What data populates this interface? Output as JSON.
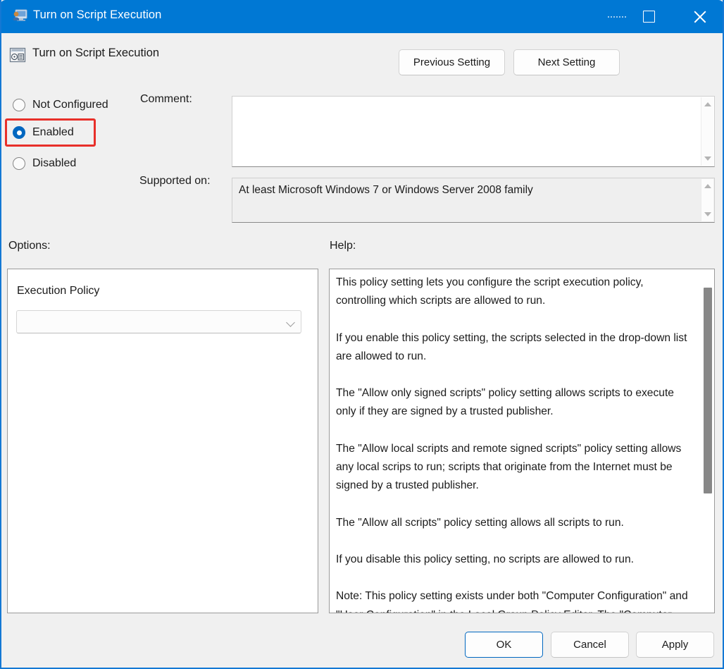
{
  "window": {
    "title": "Turn on Script Execution",
    "title_icon": "policy-monitor-icon",
    "accent_color": "#0078d4",
    "border_color": "#1478d4",
    "controls": {
      "minimize_label": "Minimize",
      "maximize_label": "Maximize",
      "close_label": "Close"
    }
  },
  "header": {
    "icon": "policy-setting-icon",
    "title": "Turn on Script Execution",
    "previous_setting_label": "Previous Setting",
    "next_setting_label": "Next Setting"
  },
  "state_options": {
    "items": [
      {
        "label": "Not Configured",
        "selected": false
      },
      {
        "label": "Enabled",
        "selected": true
      },
      {
        "label": "Disabled",
        "selected": false
      }
    ],
    "selected_value": "Enabled",
    "highlight_color": "#e8302a",
    "highlight_target": "Enabled"
  },
  "comment": {
    "label": "Comment:",
    "value": "",
    "scrollbar_up_icon": "triangle-up-icon",
    "scrollbar_down_icon": "triangle-down-icon"
  },
  "supported_on": {
    "label": "Supported on:",
    "value": "At least Microsoft Windows 7 or Windows Server 2008 family",
    "scrollbar_up_icon": "triangle-up-icon",
    "scrollbar_down_icon": "triangle-down-icon"
  },
  "options": {
    "label": "Options:",
    "execution_policy_label": "Execution Policy",
    "execution_policy_value": "",
    "execution_policy_chevron_icon": "chevron-down-icon"
  },
  "help": {
    "label": "Help:",
    "text": "This policy setting lets you configure the script execution policy, controlling which scripts are allowed to run.\n\nIf you enable this policy setting, the scripts selected in the drop-down list are allowed to run.\n\nThe \"Allow only signed scripts\" policy setting allows scripts to execute only if they are signed by a trusted publisher.\n\nThe \"Allow local scripts and remote signed scripts\" policy setting allows any local scrips to run; scripts that originate from the Internet must be signed by a trusted publisher.\n\nThe \"Allow all scripts\" policy setting allows all scripts to run.\n\nIf you disable this policy setting, no scripts are allowed to run.\n\nNote: This policy setting exists under both \"Computer Configuration\" and \"User Configuration\" in the Local Group Policy Editor. The \"Computer Configuration\" has precedence over \"User"
  },
  "footer": {
    "ok_label": "OK",
    "cancel_label": "Cancel",
    "apply_label": "Apply",
    "default_button": "OK"
  }
}
